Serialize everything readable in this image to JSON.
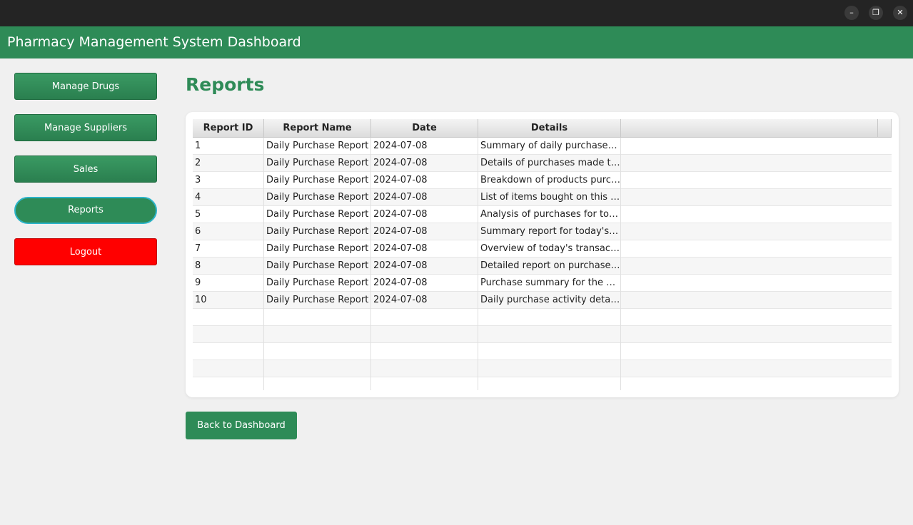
{
  "window": {
    "minimize_icon": "minimize-icon",
    "maximize_icon": "restore-icon",
    "close_icon": "close-icon"
  },
  "header": {
    "title": "Pharmacy Management System Dashboard"
  },
  "sidebar": {
    "items": [
      {
        "label": "Manage Drugs"
      },
      {
        "label": "Manage Suppliers"
      },
      {
        "label": "Sales"
      },
      {
        "label": "Reports"
      },
      {
        "label": "Logout"
      }
    ]
  },
  "main": {
    "title": "Reports",
    "table": {
      "columns": [
        "Report ID",
        "Report Name",
        "Date",
        "Details"
      ],
      "rows": [
        [
          "1",
          "Daily Purchase Report",
          "2024-07-08",
          "Summary of daily purchases made"
        ],
        [
          "2",
          "Daily Purchase Report",
          "2024-07-08",
          "Details of purchases made today"
        ],
        [
          "3",
          "Daily Purchase Report",
          "2024-07-08",
          "Breakdown of products purchased"
        ],
        [
          "4",
          "Daily Purchase Report",
          "2024-07-08",
          "List of items bought on this day"
        ],
        [
          "5",
          "Daily Purchase Report",
          "2024-07-08",
          "Analysis of purchases for today"
        ],
        [
          "6",
          "Daily Purchase Report",
          "2024-07-08",
          "Summary report for today's purchases"
        ],
        [
          "7",
          "Daily Purchase Report",
          "2024-07-08",
          "Overview of today's transactions"
        ],
        [
          "8",
          "Daily Purchase Report",
          "2024-07-08",
          "Detailed report on purchases made"
        ],
        [
          "9",
          "Daily Purchase Report",
          "2024-07-08",
          "Purchase summary for the current day"
        ],
        [
          "10",
          "Daily Purchase Report",
          "2024-07-08",
          "Daily purchase activity details"
        ]
      ]
    },
    "back_button": "Back to Dashboard"
  },
  "colors": {
    "primary": "#2e8b57",
    "danger": "#ff0000",
    "focus_ring": "#2bb3c8"
  }
}
